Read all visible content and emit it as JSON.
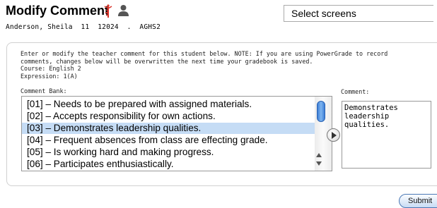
{
  "header": {
    "title": "Modify Comment",
    "icons": [
      "caduceus-icon",
      "user-icon"
    ],
    "screens_select": {
      "selected": "Select screens"
    },
    "student_line": "Anderson, Sheila  11  12024  .  AGHS2"
  },
  "instructions": {
    "line1": "Enter or modify the teacher comment for this student below. NOTE: If you are using PowerGrade to record",
    "line2": "comments, changes below will be overwritten the next time your gradebook is saved.",
    "course": "Course: English 2",
    "expression": "Expression: 1(A)"
  },
  "comment_bank": {
    "label": "Comment Bank:",
    "items": [
      {
        "text": "[01] – Needs to be prepared with assigned materials."
      },
      {
        "text": "[02] – Accepts responsibility for own actions."
      },
      {
        "text": "[03] – Demonstrates leadership qualities."
      },
      {
        "text": "[04] – Frequent absences from class are effecting grade."
      },
      {
        "text": "[05] – Is working hard and making progress."
      },
      {
        "text": "[06] – Participates enthusiastically."
      }
    ],
    "selected_index": 2
  },
  "comment": {
    "label": "Comment:",
    "value": "Demonstrates\nleadership\nqualities."
  },
  "submit_label": "Submit",
  "colors": {
    "selection": "#c5dcf5",
    "caduceus": "#d9342b",
    "user_icon": "#555555",
    "scroll_thumb": "#3d7fd6"
  }
}
